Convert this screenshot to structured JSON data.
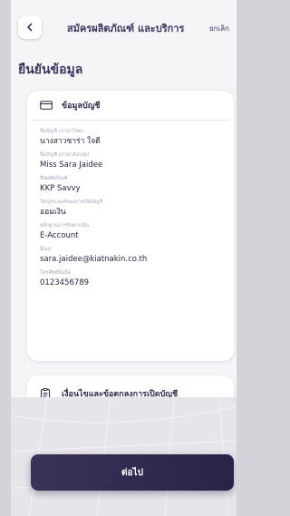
{
  "header": {
    "title": "สมัครผลิตภัณฑ์ และบริการ",
    "cancel_label": "ยกเลิก"
  },
  "page_title": "ยืนยันข้อมูล",
  "account_card": {
    "title": "ข้อมูลบัญชี",
    "fields": [
      {
        "label": "ชื่อบัญชี (ภาษาไทย)",
        "value": "นางสาวซาร่า ใจดี"
      },
      {
        "label": "ชื่อบัญชี (ภาษาอังกฤษ)",
        "value": "Miss Sara Jaidee"
      },
      {
        "label": "ชื่อผลิตภัณฑ์",
        "value": "KKP Savvy"
      },
      {
        "label": "วัตถุประสงค์ของการเปิดบัญชี",
        "value": "ออมเงิน"
      },
      {
        "label": "หลักฐานการรับฝากเงิน",
        "value": "E-Account"
      },
      {
        "label": "อีเมล",
        "value": "sara.jaidee@kiatnakin.co.th"
      },
      {
        "label": "โทรศัพท์มือถือ",
        "value": "0123456789"
      }
    ]
  },
  "terms_card": {
    "title": "เงื่อนไขและข้อตกลงการเปิดบัญชี"
  },
  "cta_label": "ต่อไป",
  "colors": {
    "primary": "#332c52",
    "text_dark": "#2a2540",
    "label_gray": "#a8a3b8",
    "screen_bg": "#f5f4f7"
  }
}
